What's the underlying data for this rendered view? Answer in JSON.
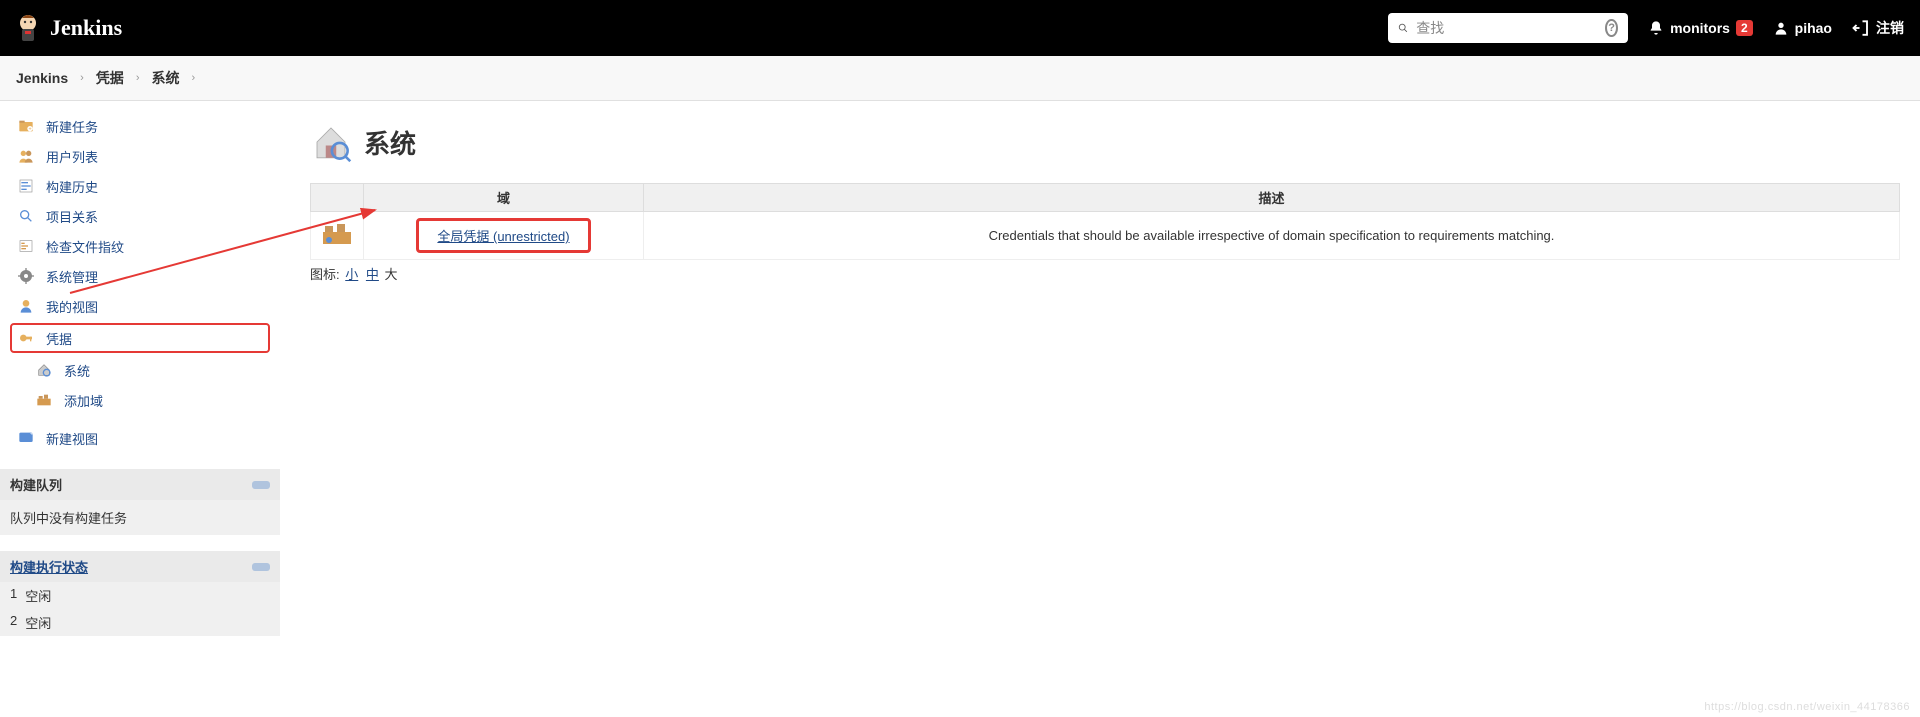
{
  "header": {
    "brand": "Jenkins",
    "search_placeholder": "查找",
    "monitors_label": "monitors",
    "monitors_count": "2",
    "user_label": "pihao",
    "logout_label": "注销"
  },
  "breadcrumb": {
    "items": [
      "Jenkins",
      "凭据",
      "系统"
    ]
  },
  "sidebar": {
    "items": [
      {
        "label": "新建任务"
      },
      {
        "label": "用户列表"
      },
      {
        "label": "构建历史"
      },
      {
        "label": "项目关系"
      },
      {
        "label": "检查文件指纹"
      },
      {
        "label": "系统管理"
      },
      {
        "label": "我的视图"
      },
      {
        "label": "凭据"
      }
    ],
    "sub_items": [
      {
        "label": "系统"
      },
      {
        "label": "添加域"
      }
    ],
    "new_view_label": "新建视图"
  },
  "build_queue": {
    "title": "构建队列",
    "empty_text": "队列中没有构建任务"
  },
  "executors": {
    "title": "构建执行状态",
    "rows": [
      {
        "num": "1",
        "status": "空闲"
      },
      {
        "num": "2",
        "status": "空闲"
      }
    ]
  },
  "main": {
    "title": "系统",
    "table": {
      "col_domain": "域",
      "col_desc": "描述",
      "rows": [
        {
          "link_text": "全局凭据 (unrestricted)",
          "description": "Credentials that should be available irrespective of domain specification to requirements matching."
        }
      ]
    },
    "icon_sizes": {
      "label": "图标:",
      "small": "小",
      "medium": "中",
      "large": "大"
    }
  },
  "watermark": "https://blog.csdn.net/weixin_44178366"
}
